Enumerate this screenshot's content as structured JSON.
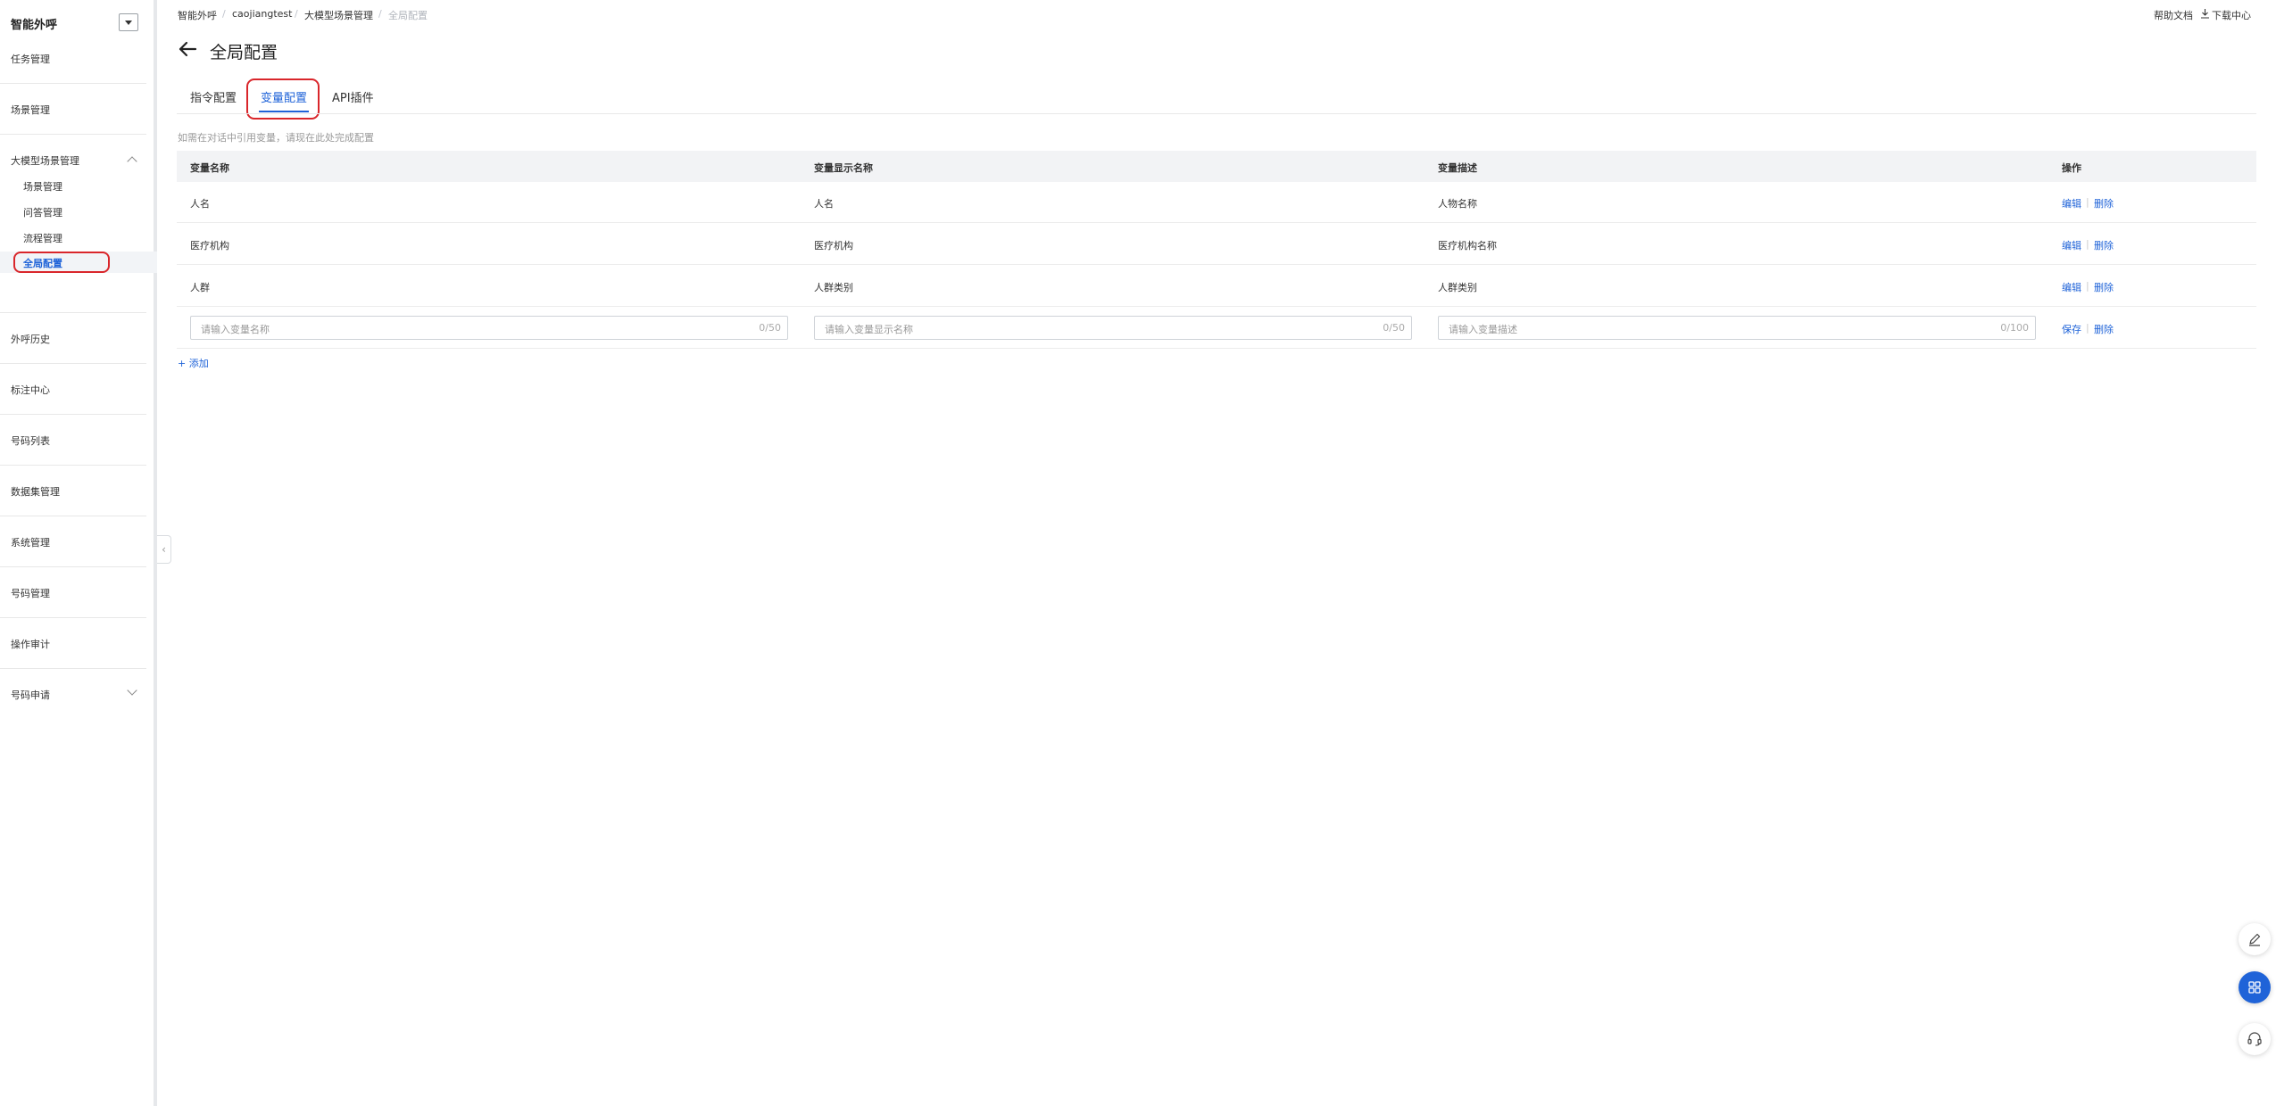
{
  "sidebar": {
    "title": "智能外呼",
    "items": {
      "task": "任务管理",
      "scene": "场景管理",
      "llm_scene": "大模型场景管理",
      "call_history": "外呼历史",
      "annotation": "标注中心",
      "number_list": "号码列表",
      "dataset": "数据集管理",
      "system": "系统管理",
      "number_mgmt": "号码管理",
      "audit": "操作审计",
      "number_apply": "号码申请"
    },
    "sub_items": {
      "scene": "场景管理",
      "qa": "问答管理",
      "flow": "流程管理",
      "global": "全局配置"
    }
  },
  "breadcrumb": [
    "智能外呼",
    "caojiangtest",
    "大模型场景管理",
    "全局配置"
  ],
  "top_links": {
    "help": "帮助文档",
    "download": "下载中心"
  },
  "page": {
    "title": "全局配置"
  },
  "tabs": [
    "指令配置",
    "变量配置",
    "API插件"
  ],
  "hint": "如需在对话中引用变量，请现在此处完成配置",
  "table": {
    "headers": [
      "变量名称",
      "变量显示名称",
      "变量描述",
      "操作"
    ],
    "rows": [
      [
        "人名",
        "人名",
        "人物名称"
      ],
      [
        "医疗机构",
        "医疗机构",
        "医疗机构名称"
      ],
      [
        "人群",
        "人群类别",
        "人群类别"
      ]
    ],
    "actions": {
      "edit": "编辑",
      "delete": "删除",
      "save": "保存"
    },
    "new_row": {
      "name_placeholder": "请输入变量名称",
      "name_count": "0/50",
      "display_placeholder": "请输入变量显示名称",
      "display_count": "0/50",
      "desc_placeholder": "请输入变量描述",
      "desc_count": "0/100"
    }
  },
  "add_label": "+ 添加",
  "colors": {
    "accent": "#1f63d8",
    "highlight": "#d9262b"
  },
  "icons": [
    "chevron-down-icon",
    "chevron-up-icon",
    "collapse-left-icon",
    "back-arrow-icon",
    "download-icon",
    "edit-icon",
    "grid-icon",
    "headset-icon"
  ]
}
